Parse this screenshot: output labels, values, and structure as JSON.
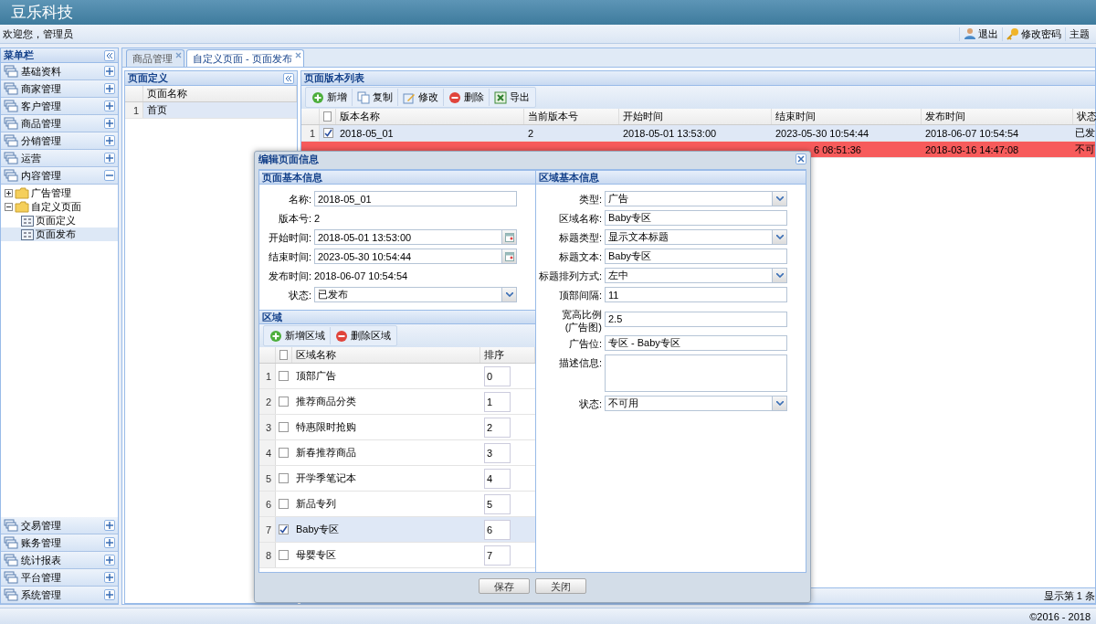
{
  "header": {
    "title": "豆乐科技"
  },
  "topbar": {
    "welcome": "欢迎您，管理员",
    "links": [
      {
        "label": "退出",
        "kind": "user"
      },
      {
        "label": "修改密码",
        "kind": "key"
      },
      {
        "label": "主题",
        "kind": "plain"
      }
    ]
  },
  "sidebar": {
    "title": "菜单栏",
    "groups": [
      {
        "label": "基础资料",
        "expanded": false
      },
      {
        "label": "商家管理",
        "expanded": false
      },
      {
        "label": "客户管理",
        "expanded": false
      },
      {
        "label": "商品管理",
        "expanded": false
      },
      {
        "label": "分销管理",
        "expanded": false
      },
      {
        "label": "运营",
        "expanded": false
      },
      {
        "label": "内容管理",
        "expanded": true,
        "children": [
          {
            "label": "广告管理",
            "kind": "folder",
            "expanded": false,
            "selected": false
          },
          {
            "label": "自定义页面",
            "kind": "folder",
            "expanded": true,
            "selected": false,
            "children": [
              {
                "label": "页面定义",
                "kind": "page",
                "selected": false
              },
              {
                "label": "页面发布",
                "kind": "page",
                "selected": true
              }
            ]
          }
        ]
      },
      {
        "label": "交易管理",
        "expanded": false
      },
      {
        "label": "账务管理",
        "expanded": false
      },
      {
        "label": "统计报表",
        "expanded": false
      },
      {
        "label": "平台管理",
        "expanded": false
      },
      {
        "label": "系统管理",
        "expanded": false
      }
    ]
  },
  "tabs": [
    {
      "label": "商品管理",
      "selected": false
    },
    {
      "label": "自定义页面 - 页面发布",
      "selected": true
    }
  ],
  "page_panel": {
    "title": "页面定义",
    "columns": [
      "页面名称"
    ],
    "rows": [
      {
        "index": "1",
        "name": "首页",
        "selected": true
      }
    ]
  },
  "version_panel": {
    "title": "页面版本列表",
    "toolbar": [
      {
        "label": "新增",
        "kind": "add"
      },
      {
        "label": "复制",
        "kind": "copy"
      },
      {
        "label": "修改",
        "kind": "edit"
      },
      {
        "label": "删除",
        "kind": "remove"
      },
      {
        "label": "导出",
        "kind": "export"
      }
    ],
    "all_checked": false,
    "columns": [
      "版本名称",
      "当前版本号",
      "开始时间",
      "结束时间",
      "发布时间",
      "状态"
    ],
    "rows": [
      {
        "index": "1",
        "checked": true,
        "selected": true,
        "kind": "normal",
        "partial": false,
        "cells": [
          "2018-05_01",
          "2",
          "2018-05-01 13:53:00",
          "2023-05-30 10:54:44",
          "2018-06-07 10:54:54",
          "已发"
        ]
      },
      {
        "kind": "error",
        "partial": true,
        "cells": [
          null,
          null,
          null,
          "6 08:51:36",
          "2018-03-16 14:47:08",
          "不可"
        ]
      }
    ],
    "pager": "显示第 1 条"
  },
  "dialog": {
    "title": "编辑页面信息",
    "basic": {
      "title": "页面基本信息",
      "fields": [
        {
          "label": "名称:",
          "kind": "text",
          "value": "2018-05_01"
        },
        {
          "label": "版本号:",
          "kind": "static",
          "value": "2"
        },
        {
          "label": "开始时间:",
          "kind": "date",
          "value": "2018-05-01 13:53:00"
        },
        {
          "label": "结束时间:",
          "kind": "date",
          "value": "2023-05-30 10:54:44"
        },
        {
          "label": "发布时间:",
          "kind": "static",
          "value": "2018-06-07 10:54:54"
        },
        {
          "label": "状态:",
          "kind": "select",
          "value": "已发布"
        }
      ]
    },
    "areas": {
      "title": "区域",
      "toolbar": [
        {
          "label": "新增区域",
          "kind": "add"
        },
        {
          "label": "删除区域",
          "kind": "remove"
        }
      ],
      "all_checked": false,
      "columns": [
        "区域名称",
        "排序"
      ],
      "rows": [
        {
          "index": "1",
          "name": "顶部广告",
          "order": "0",
          "checked": false,
          "selected": false
        },
        {
          "index": "2",
          "name": "推荐商品分类",
          "order": "1",
          "checked": false,
          "selected": false
        },
        {
          "index": "3",
          "name": "特惠限时抢购",
          "order": "2",
          "checked": false,
          "selected": false
        },
        {
          "index": "4",
          "name": "新春推荐商品",
          "order": "3",
          "checked": false,
          "selected": false
        },
        {
          "index": "5",
          "name": "开学季笔记本",
          "order": "4",
          "checked": false,
          "selected": false
        },
        {
          "index": "6",
          "name": "新品专列",
          "order": "5",
          "checked": false,
          "selected": false
        },
        {
          "index": "7",
          "name": "Baby专区",
          "order": "6",
          "checked": true,
          "selected": true
        },
        {
          "index": "8",
          "name": "母婴专区",
          "order": "7",
          "checked": false,
          "selected": false
        }
      ]
    },
    "area_info": {
      "title": "区域基本信息",
      "fields": [
        {
          "label": "类型:",
          "kind": "select",
          "value": "广告"
        },
        {
          "label": "区域名称:",
          "kind": "text",
          "value": "Baby专区"
        },
        {
          "label": "标题类型:",
          "kind": "select",
          "value": "显示文本标题"
        },
        {
          "label": "标题文本:",
          "kind": "text",
          "value": "Baby专区"
        },
        {
          "label": "标题排列方式:",
          "kind": "select",
          "value": "左中"
        },
        {
          "label": "顶部间隔:",
          "kind": "text",
          "value": "11"
        },
        {
          "label": "宽高比例\n(广告图)",
          "kind": "text",
          "value": "2.5"
        },
        {
          "label": "广告位:",
          "kind": "text",
          "value": "专区 - Baby专区"
        },
        {
          "label": "描述信息:",
          "kind": "textarea"
        },
        {
          "label": "状态:",
          "kind": "select",
          "value": "不可用"
        }
      ]
    },
    "buttons": [
      {
        "label": "保存"
      },
      {
        "label": "关闭"
      }
    ]
  },
  "footer": {
    "copyright": "©2016 - 2018"
  }
}
